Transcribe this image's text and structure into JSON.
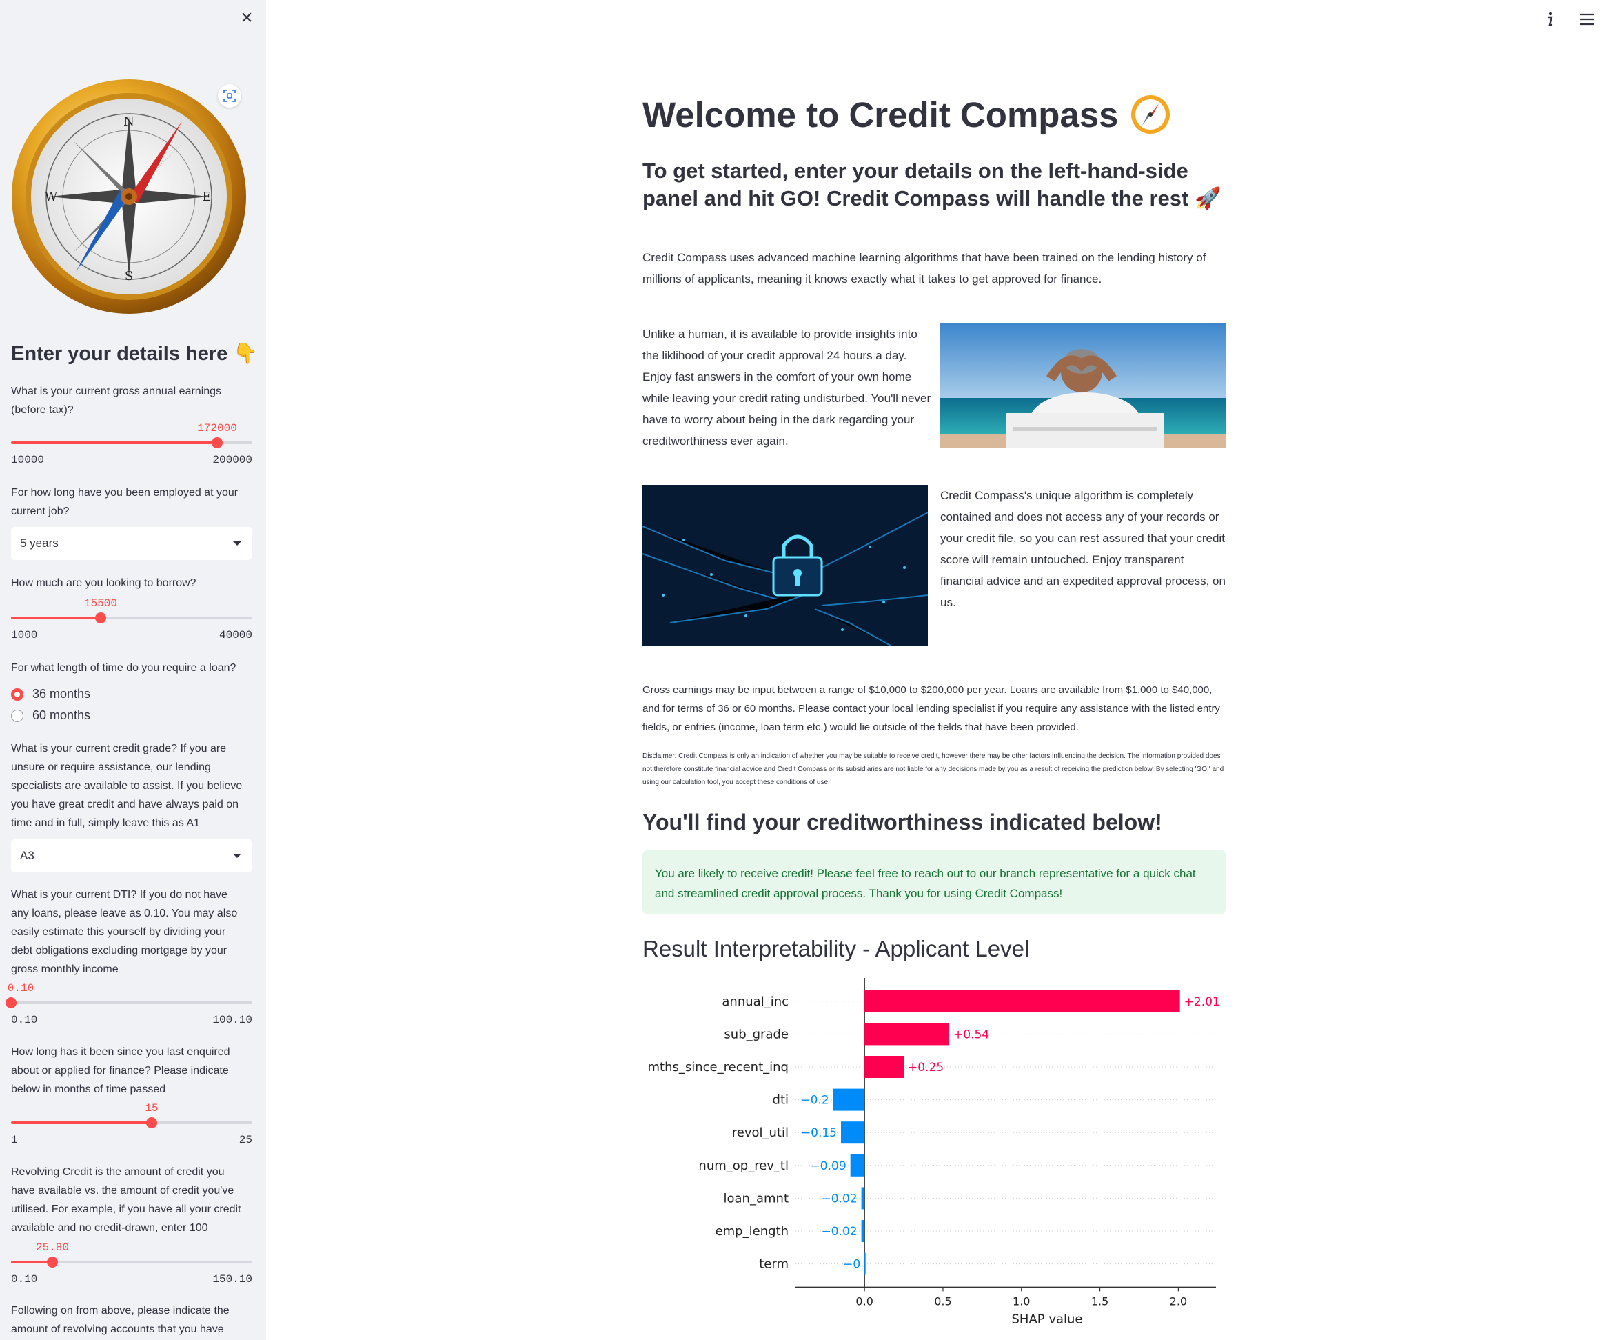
{
  "sidebar": {
    "heading": "Enter your details here 👇",
    "q_income": "What is your current gross annual earnings (before tax)?",
    "income_slider": {
      "value": "172000",
      "min": "10000",
      "max": "200000",
      "fraction": 0.853
    },
    "q_emp": "For how long have you been employed at your current job?",
    "emp_select": "5 years",
    "q_borrow": "How much are you looking to borrow?",
    "borrow_slider": {
      "value": "15500",
      "min": "1000",
      "max": "40000",
      "fraction": 0.372
    },
    "q_term": "For what length of time do you require a loan?",
    "term_options": [
      "36 months",
      "60 months"
    ],
    "term_selected": "36 months",
    "q_grade": "What is your current credit grade? If you are unsure or require assistance, our lending specialists are available to assist. If you believe you have great credit and have always paid on time and in full, simply leave this as A1",
    "grade_select": "A3",
    "q_dti": "What is your current DTI? If you do not have any loans, please leave as 0.10. You may also easily estimate this yourself by dividing your debt obligations excluding mortgage by your gross monthly income",
    "dti_slider": {
      "value": "0.10",
      "min": "0.10",
      "max": "100.10",
      "fraction": 0.0
    },
    "q_inq": "How long has it been since you last enquired about or applied for finance? Please indicate below in months of time passed",
    "inq_slider": {
      "value": "15",
      "min": "1",
      "max": "25",
      "fraction": 0.583
    },
    "q_revol": "Revolving Credit is the amount of credit you have available vs. the amount of credit you've utilised. For example, if you have all your credit available and no credit-drawn, enter 100",
    "revol_slider": {
      "value": "25.80",
      "min": "0.10",
      "max": "150.10",
      "fraction": 0.171
    },
    "q_accounts": "Following on from above, please indicate the amount of revolving accounts that you have open,"
  },
  "main": {
    "title": "Welcome to Credit Compass",
    "subtitle": "To get started, enter your details on the left-hand-side panel and hit GO! Credit Compass will handle the rest 🚀",
    "intro": "Credit Compass uses advanced machine learning algorithms that have been trained on the lending history of millions of applicants, meaning it knows exactly what it takes to get approved for finance.",
    "para_human": "Unlike a human, it is available to provide insights into the liklihood of your credit approval 24 hours a day. Enjoy fast answers in the comfort of your own home while leaving your credit rating undisturbed. You'll never have to worry about being in the dark regarding your creditworthiness ever again.",
    "para_algo": "Credit Compass's unique algorithm is completely contained and does not access any of your records or your credit file, so you can rest assured that your credit score will remain untouched. Enjoy transparent financial advice and an expedited approval process, on us.",
    "ranges": "Gross earnings may be input between a range of $10,000 to $200,000 per year. Loans are available from $1,000 to $40,000, and for terms of 36 or 60 months. Please contact your local lending specialist if you require any assistance with the listed entry fields, or entries (income, loan term etc.) would lie outside of the fields that have been provided.",
    "disclaimer": "Disclaimer: Credit Compass is only an indication of whether you may be suitable to receive credit, however there may be other factors influencing the decision. The information provided does not therefore constitute financial advice and Credit Compass or its subsidiaries are not liable for any decisions made by you as a result of receiving the prediction below. By selecting 'GO!' and using our calculation tool, you accept these conditions of use.",
    "result_heading": "You'll find your creditworthiness indicated below!",
    "result_text": "You are likely to receive credit! Please feel free to reach out to our branch representative for a quick chat and streamlined credit approval process. Thank you for using Credit Compass!",
    "interp_heading": "Result Interpretability - Applicant Level"
  },
  "colors": {
    "accent": "#ff4b4b",
    "positive": "#ff0051",
    "negative": "#008bfb",
    "success_bg": "#e8f7ec",
    "success_text": "#177233"
  },
  "chart_data": {
    "type": "bar",
    "orientation": "horizontal",
    "xlabel": "SHAP value",
    "categories": [
      "annual_inc",
      "sub_grade",
      "mths_since_recent_inq",
      "dti",
      "revol_util",
      "num_op_rev_tl",
      "loan_amnt",
      "emp_length",
      "term"
    ],
    "values": [
      2.01,
      0.54,
      0.25,
      -0.2,
      -0.15,
      -0.09,
      -0.02,
      -0.02,
      -0.0
    ],
    "labels": [
      "+2.01",
      "+0.54",
      "+0.25",
      "−0.2",
      "−0.15",
      "−0.09",
      "−0.02",
      "−0.02",
      "−0"
    ],
    "xticks": [
      "0.0",
      "0.5",
      "1.0",
      "1.5",
      "2.0"
    ],
    "xtick_values": [
      0,
      0.5,
      1.0,
      1.5,
      2.0
    ],
    "xlim": [
      -0.44,
      2.24
    ]
  }
}
